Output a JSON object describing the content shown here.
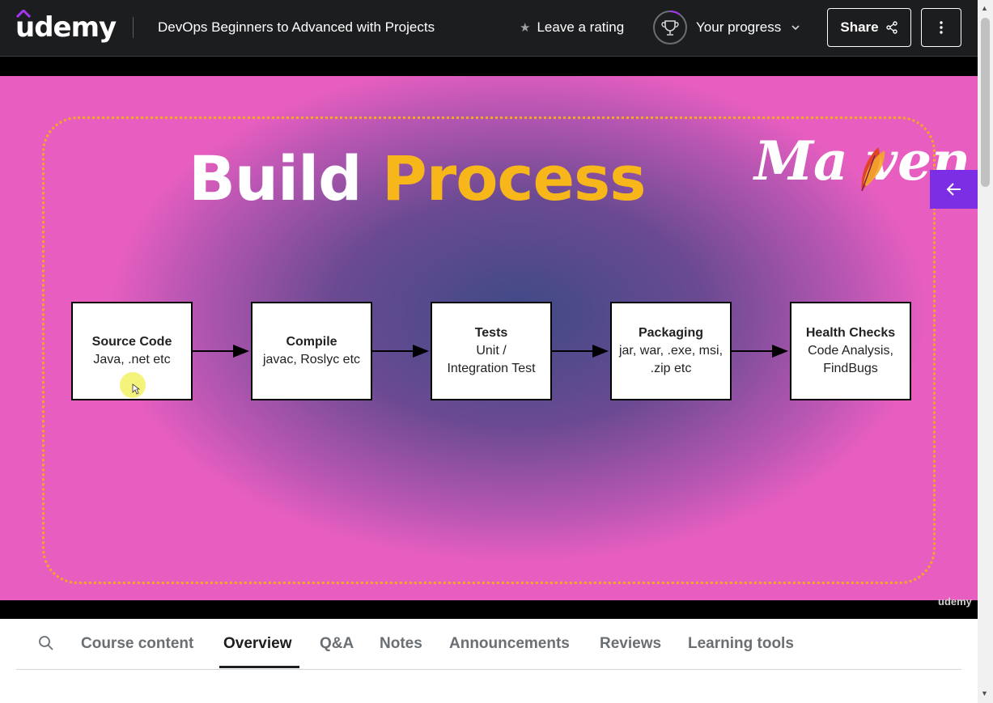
{
  "header": {
    "logo_text": "udemy",
    "course_title": "DevOps Beginners to Advanced with Projects",
    "rating_label": "Leave a rating",
    "progress_label": "Your progress",
    "share_label": "Share"
  },
  "video": {
    "slide_title_part1": "Build",
    "slide_title_part2": "Process",
    "maven_logo_text": "Ma ven",
    "boxes": [
      {
        "title": "Source Code",
        "line1": "Java, .net etc",
        "line2": ""
      },
      {
        "title": "Compile",
        "line1": "javac, Roslyc etc",
        "line2": ""
      },
      {
        "title": "Tests",
        "line1": "Unit /",
        "line2": "Integration Test"
      },
      {
        "title": "Packaging",
        "line1": "jar, war, .exe, msi,",
        "line2": ".zip etc"
      },
      {
        "title": "Health Checks",
        "line1": "Code Analysis,",
        "line2": "FindBugs"
      }
    ],
    "watermark": "udemy"
  },
  "tabs": [
    {
      "label": "Course content"
    },
    {
      "label": "Overview",
      "active": true
    },
    {
      "label": "Q&A"
    },
    {
      "label": "Notes"
    },
    {
      "label": "Announcements"
    },
    {
      "label": "Reviews"
    },
    {
      "label": "Learning tools"
    }
  ],
  "colors": {
    "header_bg": "#1c1d1f",
    "accent_purple": "#7c2ee4",
    "slide_title_highlight": "#f7b71a",
    "dotted_border": "#f5a623"
  },
  "icons": [
    "udemy-logo-hat",
    "star-icon",
    "trophy-icon",
    "chevron-down-icon",
    "share-icon",
    "more-vertical-icon",
    "arrow-left-icon",
    "search-icon",
    "maven-feather-icon"
  ]
}
